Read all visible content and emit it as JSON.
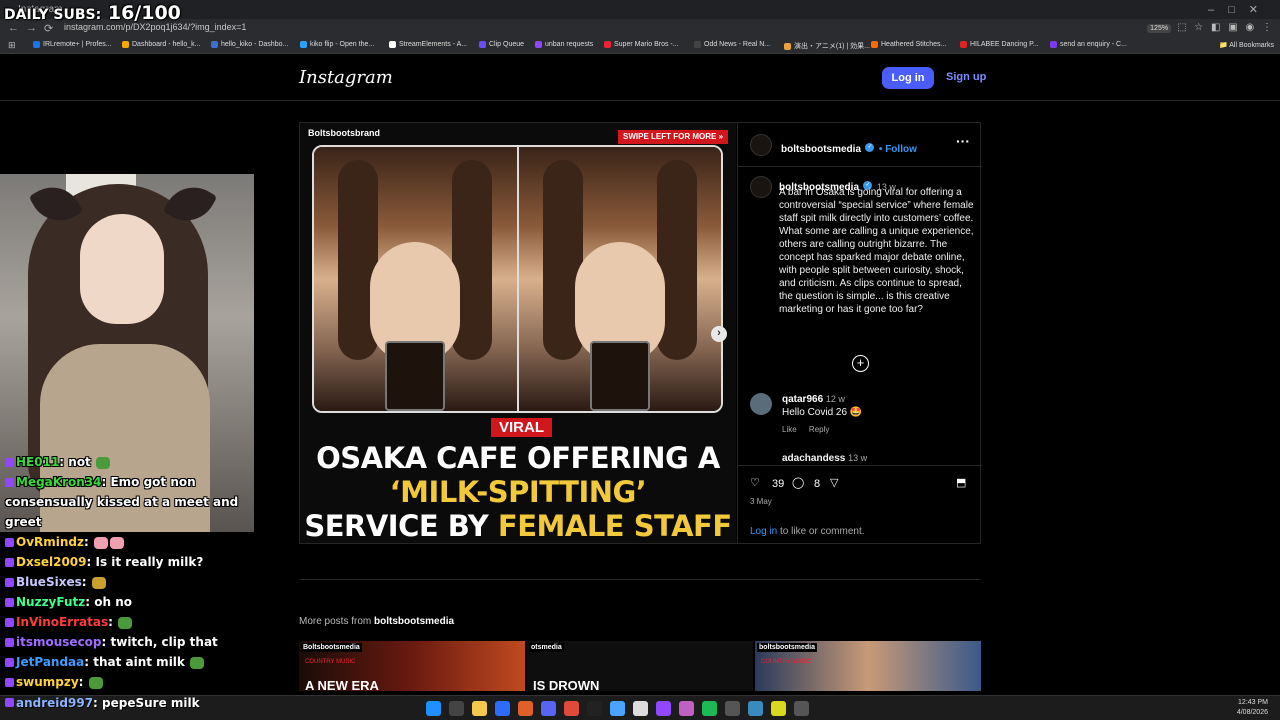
{
  "overlay": {
    "daily_subs_label": "DAILY SUBS:",
    "daily_subs_value": "16/100"
  },
  "browser": {
    "tab_title": "Instagram",
    "url": "instagram.com/p/DX2poq1j634/?img_index=1",
    "zoom": "125%",
    "bookmarks": [
      {
        "label": "IRLremote+ | Profes...",
        "color": "#1a73e8"
      },
      {
        "label": "Dashboard - hello_k...",
        "color": "#f2a900"
      },
      {
        "label": "hello_kiko - Dashbo...",
        "color": "#3b6fd4"
      },
      {
        "label": "kiko flip - Open the...",
        "color": "#2aa1ff"
      },
      {
        "label": "StreamElements - A...",
        "color": "#ffffff"
      },
      {
        "label": "Clip Queue",
        "color": "#6b4cff"
      },
      {
        "label": "unban requests",
        "color": "#9146ff"
      },
      {
        "label": "Super Mario Bros -...",
        "color": "#e23"
      },
      {
        "label": "Odd News - Real N...",
        "color": "#444"
      },
      {
        "label": "演出・アニメ(1) | 効果...",
        "color": "#e8a43a"
      },
      {
        "label": "Heathered Stitches...",
        "color": "#ff6a00"
      },
      {
        "label": "HILABEE Dancing P...",
        "color": "#e02424"
      },
      {
        "label": "send an enquiry - C...",
        "color": "#7c3aed"
      }
    ],
    "all_bookmarks": "All Bookmarks"
  },
  "instagram": {
    "logo": "Instagram",
    "login": "Log in",
    "signup": "Sign up",
    "post": {
      "brand_tag": "Boltsbootsbrand",
      "swipe_label": "SWIPE LEFT FOR MORE",
      "viral_tag": "VIRAL",
      "headline_1": "OSAKA CAFE OFFERING A",
      "headline_2": "‘MILK-SPITTING’",
      "headline_3a": "SERVICE BY ",
      "headline_3b": "FEMALE STAFF",
      "username": "boltsbootsmedia",
      "follow": "• Follow",
      "caption_user": "boltsbootsmedia",
      "caption_age": "13 w",
      "caption": "A bar in Osaka is going viral for offering a controversial “special service” where female staff spit milk directly into customers’ coffee. What some are calling a unique experience, others are calling outright bizarre. The concept has sparked major debate online, with people split between curiosity, shock, and criticism. As clips continue to spread, the question is simple... is this creative marketing or has it gone too far?",
      "comments": [
        {
          "user": "qatar966",
          "age": "12 w",
          "text": "Hello Covid 26 🤩",
          "like": "Like",
          "reply": "Reply"
        }
      ],
      "comment2_user": "adachandess",
      "comment2_age": "13 w",
      "likes": "39",
      "comment_count": "8",
      "date": "3 May",
      "login_link": "Log in",
      "login_suffix": " to like or comment."
    },
    "more_posts_label": "More posts from ",
    "more_posts_user": "boltsbootsmedia",
    "thumbs": [
      {
        "brand": "Boltsbootsmedia",
        "sub": "COUNTRY MUSIC",
        "big": "A NEW ERA"
      },
      {
        "brand": "otsmedia",
        "sub": "",
        "big": "IS DROWN"
      },
      {
        "brand": "boltsbootsmedia",
        "sub": "COUNTRY MUSIC",
        "big": ""
      }
    ]
  },
  "chat": [
    {
      "user": "HE011",
      "color": "#3cd73c",
      "text": ": not "
    },
    {
      "user": "MegaKron34",
      "color": "#3cd73c",
      "text": ": Emo got non consensually kissed at a meet and greet"
    },
    {
      "user": "OvRmindz",
      "color": "#ffd23c",
      "text": ": "
    },
    {
      "user": "Dxsel2009",
      "color": "#ffd23c",
      "text": ": Is it really milk?"
    },
    {
      "user": "BlueSixes",
      "color": "#c8c8ff",
      "text": ": "
    },
    {
      "user": "NuzzyFutz",
      "color": "#3cff8c",
      "text": ": oh no"
    },
    {
      "user": "InVinoErratas",
      "color": "#ff3c3c",
      "text": ": "
    },
    {
      "user": "itsmousecop",
      "color": "#a06bff",
      "text": ": twitch, clip that"
    },
    {
      "user": "JetPandaa",
      "color": "#3c9cff",
      "text": ": that aint milk "
    },
    {
      "user": "swumpzy",
      "color": "#ffd23c",
      "text": ": "
    }
  ],
  "chat_last": {
    "user": "andreid997",
    "text": ": pepeSure milk"
  },
  "taskbar": {
    "time": "12:43 PM",
    "date": "4/08/2026"
  }
}
